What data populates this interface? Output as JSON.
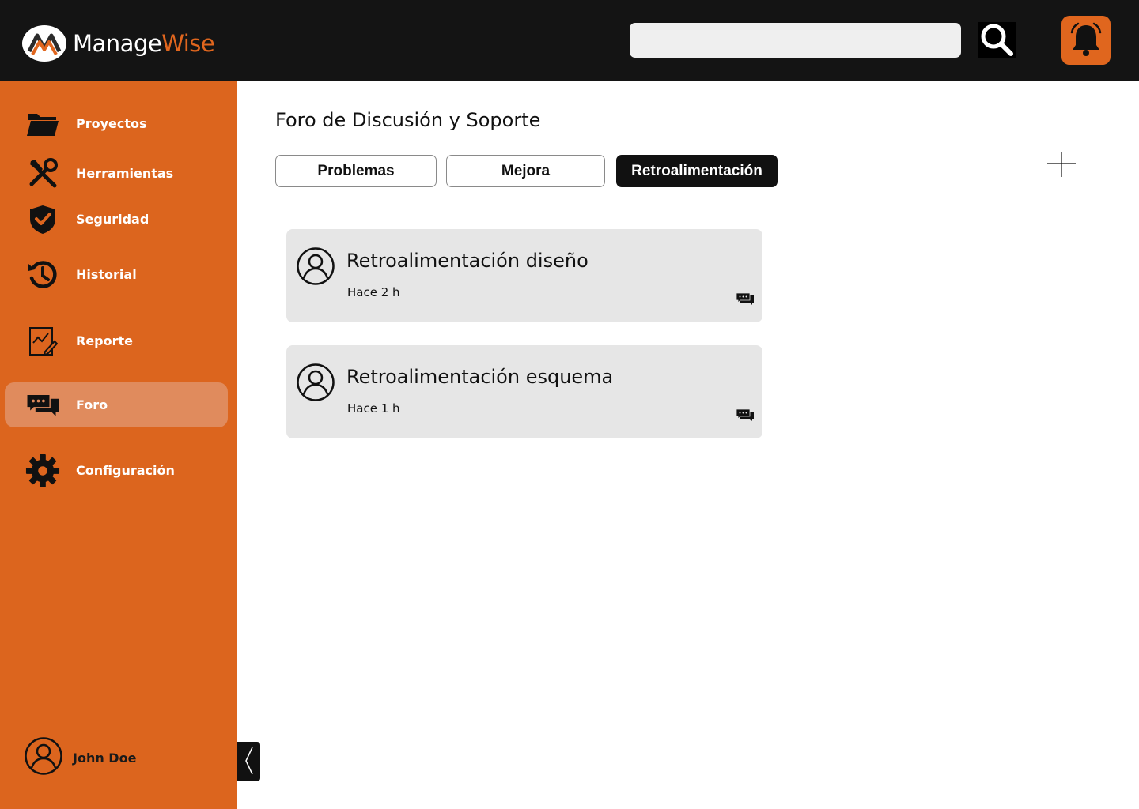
{
  "app": {
    "logo_part1": "Manage",
    "logo_part2": "Wise",
    "brand_color": "#dc651e",
    "active_color": "#e08b5d",
    "topbar_color": "#141414"
  },
  "header": {
    "search_placeholder": "",
    "search_icon": "search-icon",
    "notification_icon": "bell-icon"
  },
  "sidebar": {
    "items": [
      {
        "label": "Proyectos",
        "icon": "folder-icon"
      },
      {
        "label": "Herramientas",
        "icon": "tools-icon"
      },
      {
        "label": "Seguridad",
        "icon": "shield-icon"
      },
      {
        "label": "Historial",
        "icon": "history-icon"
      },
      {
        "label": "Reporte",
        "icon": "report-icon"
      },
      {
        "label": "Foro",
        "icon": "chat-icon",
        "active": true
      },
      {
        "label": "Configuración",
        "icon": "gear-icon"
      }
    ],
    "user_name": "John Doe"
  },
  "main": {
    "title": "Foro de Discusión y Soporte",
    "tabs": [
      {
        "label": "Problemas"
      },
      {
        "label": "Mejora"
      },
      {
        "label": "Retroalimentación",
        "active": true
      }
    ],
    "posts": [
      {
        "title": "Retroalimentación diseño",
        "time": "Hace 2 h"
      },
      {
        "title": "Retroalimentación esquema",
        "time": "Hace 1 h"
      }
    ]
  }
}
